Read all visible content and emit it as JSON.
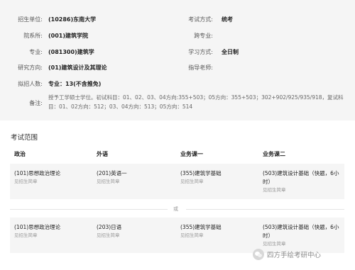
{
  "info": {
    "school_label": "招生单位:",
    "school_value": "(10286)东南大学",
    "exam_mode_label": "考试方式:",
    "exam_mode_value": "统考",
    "dept_label": "院系所:",
    "dept_value": "(001)建筑学院",
    "cross_label": "跨专业:",
    "cross_value": "",
    "major_label": "专业:",
    "major_value": "(081300)建筑学",
    "study_mode_label": "学习方式:",
    "study_mode_value": "全日制",
    "direction_label": "研究方向:",
    "direction_value": "(01)建筑设计及其理论",
    "advisor_label": "指导老师:",
    "advisor_value": "",
    "quota_label": "拟招人数:",
    "quota_value": "专业：13(不含推免)",
    "note_label": "备注:",
    "note_value": "授予工学硕士学位。初试科目：01、02、03、04方向:355+503；05方向：355+503；302+902/925/935/918，复试科目：01、02方向：512；03、04方向：513；05方向：514"
  },
  "exam_scope": {
    "title": "考试范围",
    "headers": [
      "政治",
      "外语",
      "业务课一",
      "业务课二"
    ],
    "or_text": "或",
    "groups": [
      [
        {
          "main": "(101)思想政治理论",
          "sub": "见招生简章"
        },
        {
          "main": "(201)英语一",
          "sub": "见招生简章"
        },
        {
          "main": "(355)建筑学基础",
          "sub": "见招生简章"
        },
        {
          "main": "(503)建筑设计基础（快题，6小时）",
          "sub": "见招生简章"
        }
      ],
      [
        {
          "main": "(101)思想政治理论",
          "sub": "见招生简章"
        },
        {
          "main": "(203)日语",
          "sub": "见招生简章"
        },
        {
          "main": "(355)建筑学基础",
          "sub": "见招生简章"
        },
        {
          "main": "(503)建筑设计基础（快题，6小时）",
          "sub": "见招生简章"
        }
      ]
    ]
  },
  "watermark": {
    "text": "四方手绘考研中心",
    "icon": "wechat-icon"
  }
}
